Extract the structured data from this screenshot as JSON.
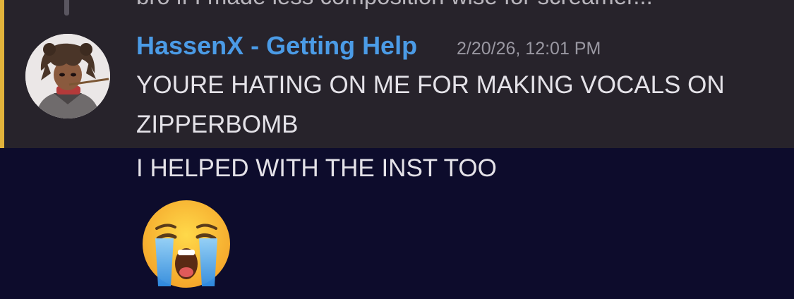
{
  "reply_preview": {
    "text": "bro if I made less composition wise for screamer..."
  },
  "message": {
    "author": "HassenX - Getting Help",
    "timestamp": "2/20/26, 12:01 PM",
    "lines": [
      "YOURE HATING ON ME FOR MAKING VOCALS ON",
      "ZIPPERBOMB",
      "I HELPED WITH THE INST TOO"
    ],
    "emoji": "loudly-crying-face-icon",
    "avatar": "user-avatar"
  },
  "colors": {
    "mention_highlight": "#27232b",
    "mention_bar": "#e2b33b",
    "username": "#4b9be6",
    "background": "#0d0c2c"
  }
}
